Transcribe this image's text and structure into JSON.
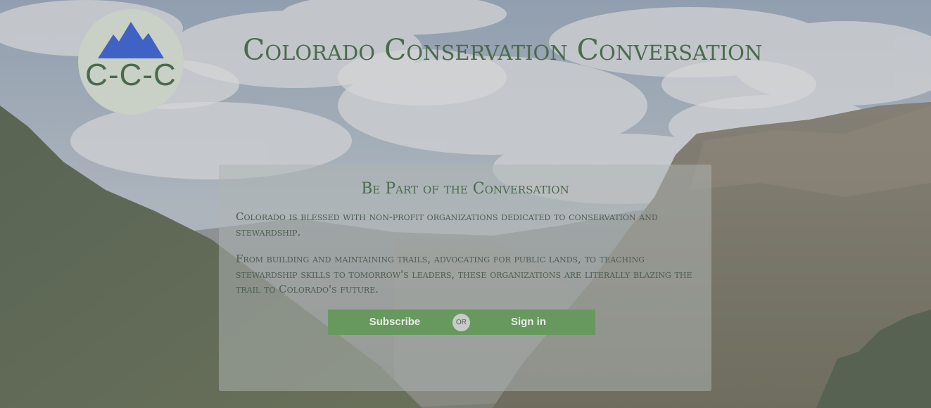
{
  "logo": {
    "text": "C-C-C",
    "icon": "mountain-icon",
    "mountain_color": "#3f62c4",
    "circle_color": "#c9d0c6"
  },
  "header": {
    "title": "Colorado Conservation Conversation"
  },
  "panel": {
    "title": "Be Part of the Conversation",
    "paragraph_1": "Colorado is blessed with non-profit organizations dedicated to conservation and stewardship.",
    "paragraph_2": "From building and maintaining trails, advocating for public lands, to teaching stewardship skills to tomorrow's leaders, these organizations are literally blazing the trail to Colorado's future."
  },
  "actions": {
    "subscribe_label": "Subscribe",
    "or_label": "or",
    "signin_label": "Sign in"
  },
  "colors": {
    "title_green": "#4b6a4d",
    "button_green": "#67995f"
  }
}
